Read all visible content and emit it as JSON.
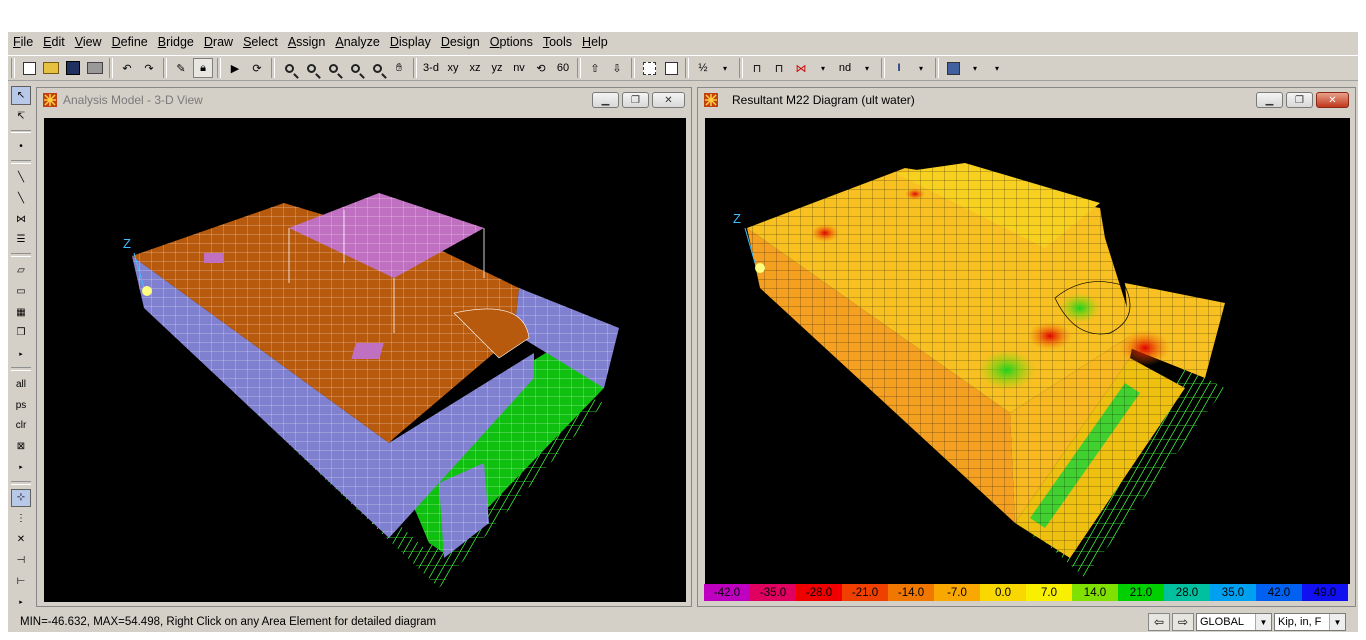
{
  "menu": [
    "File",
    "Edit",
    "View",
    "Define",
    "Bridge",
    "Draw",
    "Select",
    "Assign",
    "Analyze",
    "Display",
    "Design",
    "Options",
    "Tools",
    "Help"
  ],
  "toolbar": {
    "view_3d": "3-d",
    "view_xy": "xy",
    "view_xz": "xz",
    "view_yz": "yz",
    "view_nv": "nv",
    "view_60": "60",
    "nd": "nd",
    "percent": "½"
  },
  "left_tools": {
    "all": "all",
    "ps": "ps",
    "clr": "clr"
  },
  "left_window": {
    "title": "Analysis Model - 3-D View",
    "axis_label": "Z"
  },
  "right_window": {
    "title": "Resultant M22 Diagram   (ult water)",
    "axis_label": "Z"
  },
  "legend": {
    "values": [
      "-42.0",
      "-35.0",
      "-28.0",
      "-21.0",
      "-14.0",
      "-7.0",
      "0.0",
      "7.0",
      "14.0",
      "21.0",
      "28.0",
      "35.0",
      "42.0",
      "49.0"
    ],
    "colors": [
      "#c000c0",
      "#e00060",
      "#f00000",
      "#f04000",
      "#f07800",
      "#f8a800",
      "#f8d800",
      "#f8f000",
      "#80e000",
      "#00d000",
      "#00c0a0",
      "#00a0f0",
      "#0060f0",
      "#1010f0"
    ]
  },
  "status": {
    "text": "MIN=-46.632, MAX=54.498, Right Click on any Area Element for detailed diagram",
    "coord_system": "GLOBAL",
    "units": "Kip, in, F"
  },
  "colors": {
    "slab": "#b85a0e",
    "wall": "#8080d0",
    "roof": "#c070c0",
    "base": "#10c010",
    "support": "#20d020"
  }
}
